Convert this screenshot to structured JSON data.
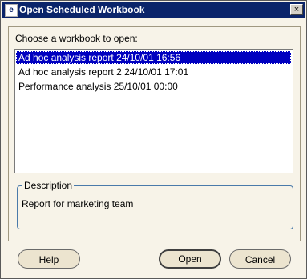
{
  "window": {
    "title": "Open Scheduled Workbook",
    "app_icon_glyph": "e",
    "close_glyph": "×"
  },
  "main": {
    "choose_label": "Choose a workbook to open:",
    "workbooks": [
      {
        "label": "Ad hoc analysis report  24/10/01 16:56",
        "selected": true
      },
      {
        "label": "Ad hoc analysis report 2  24/10/01 17:01",
        "selected": false
      },
      {
        "label": "Performance analysis  25/10/01 00:00",
        "selected": false
      }
    ],
    "description_legend": "Description",
    "description_text": "Report for marketing team"
  },
  "buttons": {
    "help_label": "Help",
    "open_label": "Open",
    "cancel_label": "Cancel"
  },
  "colors": {
    "titlebar": "#0a246a",
    "selection": "#0000c0",
    "dialog_bg": "#f7f3e8"
  }
}
